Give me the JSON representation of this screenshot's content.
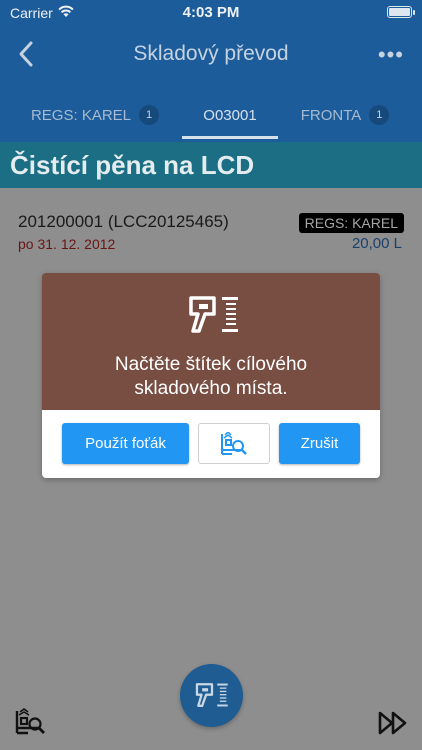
{
  "status_bar": {
    "carrier": "Carrier",
    "time": "4:03 PM"
  },
  "nav": {
    "title": "Skladový převod",
    "back_icon": "chevron-left-icon",
    "more_icon": "ellipsis-icon",
    "more_glyph": "•••"
  },
  "tabs": [
    {
      "label": "REGS: KAREL",
      "badge": "1",
      "active": false
    },
    {
      "label": "O03001",
      "badge": "",
      "active": true
    },
    {
      "label": "FRONTA",
      "badge": "1",
      "active": false
    }
  ],
  "product": {
    "name": "Čistící pěna na LCD"
  },
  "item": {
    "code": "201200001 (LCC20125465)",
    "date": "po 31. 12. 2012",
    "location": "REGS: KAREL",
    "quantity": "20,00 L"
  },
  "dialog": {
    "icon": "barcode-scanner-icon",
    "message_line1": "Načtěte štítek cílového",
    "message_line2": "skladového místa.",
    "use_camera_label": "Použít foťák",
    "location_search_icon": "shelf-search-icon",
    "cancel_label": "Zrušit"
  },
  "bottom_bar": {
    "left_icon": "shelf-search-icon",
    "center_icon": "barcode-scanner-icon",
    "right_icon": "fast-forward-icon"
  },
  "colors": {
    "primary": "#2196f3",
    "dialog_header": "#784e42",
    "overlay_bg": "#8e8e8e"
  }
}
